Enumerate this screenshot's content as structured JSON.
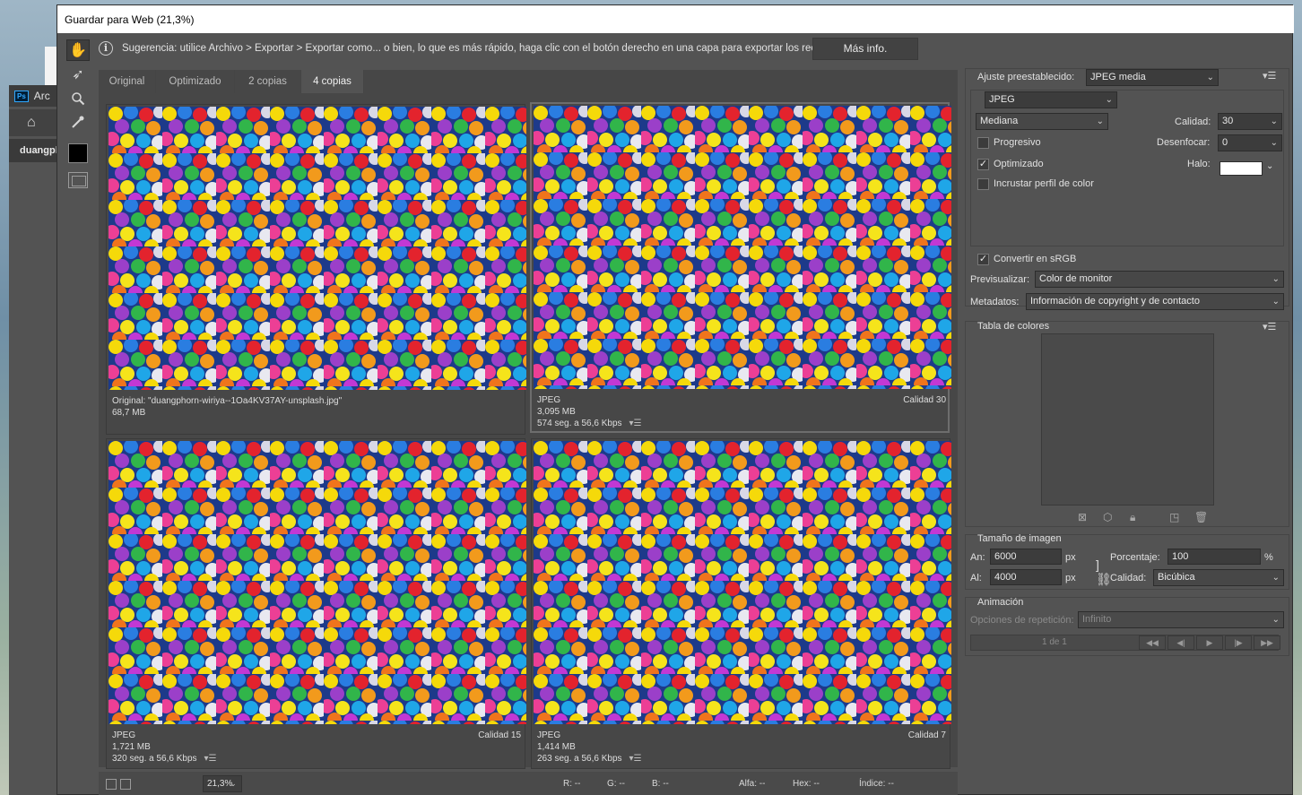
{
  "background": {
    "ps_title": "Arc",
    "ps_logo": "Ps",
    "ps_doc_tab": "duangpl"
  },
  "dialog": {
    "title": "Guardar para Web (21,3%)"
  },
  "hint": {
    "text": "Sugerencia: utilice Archivo > Exportar > Exportar como... o bien, lo que es más rápido, haga clic con el botón derecho en una capa para exportar los recursos",
    "more_info": "Más info.",
    "icon": "info-icon"
  },
  "tools": [
    "hand-icon",
    "slice-select-icon",
    "zoom-icon",
    "eyedropper-icon"
  ],
  "tabs": [
    {
      "label": "Original"
    },
    {
      "label": "Optimizado"
    },
    {
      "label": "2 copias"
    },
    {
      "label": "4 copias"
    }
  ],
  "panes": [
    {
      "line1": "Original: \"duangphorn-wiriya--1Oa4KV37AY-unsplash.jpg\"",
      "line2": "68,7 MB",
      "line3": "",
      "quality": ""
    },
    {
      "line1": "JPEG",
      "line2": "3,095 MB",
      "line3": "574 seg. a 56,6 Kbps",
      "quality": "Calidad 30"
    },
    {
      "line1": "JPEG",
      "line2": "1,721 MB",
      "line3": "320 seg. a 56,6 Kbps",
      "quality": "Calidad 15"
    },
    {
      "line1": "JPEG",
      "line2": "1,414 MB",
      "line3": "263 seg. a 56,6 Kbps",
      "quality": "Calidad 7"
    }
  ],
  "status": {
    "zoom": "21,3%",
    "r": "R: --",
    "g": "G: --",
    "b": "B: --",
    "alpha": "Alfa: --",
    "hex": "Hex: --",
    "index": "Índice: --"
  },
  "settings": {
    "preset_label": "Ajuste preestablecido:",
    "preset_value": "JPEG media",
    "format": "JPEG",
    "quality_preset": "Mediana",
    "quality_label": "Calidad:",
    "quality_value": "30",
    "progressive": "Progresivo",
    "blur_label": "Desenfocar:",
    "blur_value": "0",
    "optimized": "Optimizado",
    "halo_label": "Halo:",
    "embed_profile": "Incrustar perfil de color",
    "convert_srgb": "Convertir en sRGB",
    "preview_label": "Previsualizar:",
    "preview_value": "Color de monitor",
    "metadata_label": "Metadatos:",
    "metadata_value": "Información de copyright y de contacto",
    "color_table_label": "Tabla de colores",
    "image_size_label": "Tamaño de imagen",
    "width_label": "An:",
    "width_value": "6000",
    "height_label": "Al:",
    "height_value": "4000",
    "px": "px",
    "percent_label": "Porcentaje:",
    "percent_value": "100",
    "percent_unit": "%",
    "resample_label": "Calidad:",
    "resample_value": "Bicúbica",
    "animation_label": "Animación",
    "loop_label": "Opciones de repetición:",
    "loop_value": "Infinito",
    "frame_counter": "1 de 1"
  },
  "colors": {
    "dialog_bg": "#535353",
    "panel_bg": "#474747",
    "accent_white": "#ffffff"
  }
}
